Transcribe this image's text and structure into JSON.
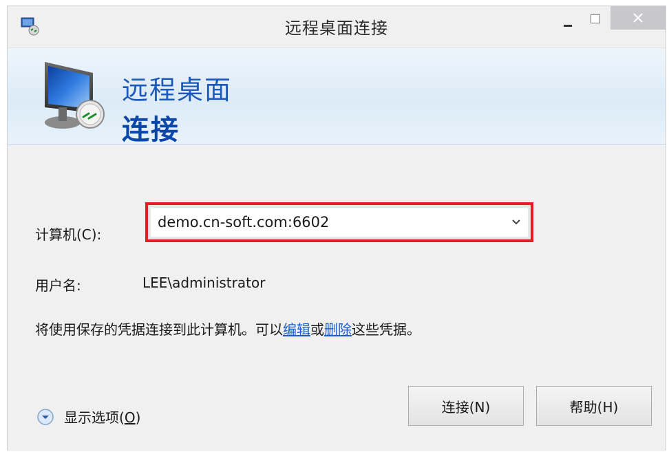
{
  "window": {
    "title": "远程桌面连接"
  },
  "banner": {
    "line1": "远程桌面",
    "line2": "连接"
  },
  "form": {
    "computer_label": "计算机(C):",
    "computer_value": "demo.cn-soft.com:6602",
    "username_label": "用户名:",
    "username_value": "LEE\\administrator"
  },
  "info": {
    "prefix": "将使用保存的凭据连接到此计算机。可以",
    "edit_link": "编辑",
    "middle": "或",
    "delete_link": "删除",
    "suffix": "这些凭据。"
  },
  "options": {
    "label_main": "显示选项(",
    "label_accel": "O",
    "label_end": ")"
  },
  "buttons": {
    "connect": "连接(N)",
    "help": "帮助(H)"
  },
  "colors": {
    "highlight_border": "#e21d24",
    "banner_text": "#1d5ab8",
    "link": "#1c5dcc"
  },
  "icons": {
    "app": "remote-desktop-icon",
    "banner": "remote-desktop-monitor-icon",
    "expand": "chevron-down-circle-icon",
    "dropdown": "chevron-down-icon"
  }
}
